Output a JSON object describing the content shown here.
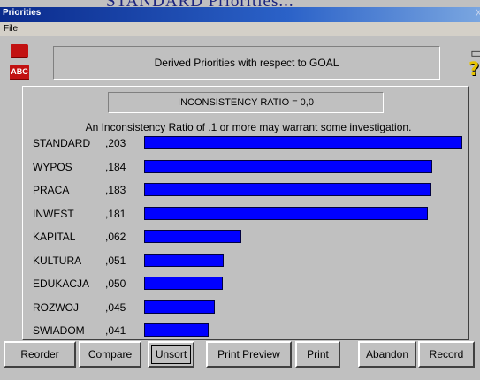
{
  "background_title": "STANDARD  Priorities...",
  "window": {
    "title": "Priorities",
    "close": "X"
  },
  "menu": {
    "file": "File"
  },
  "toolbar": {
    "abc_icon_text": "ABC"
  },
  "header": {
    "text": "Derived Priorities with respect to GOAL"
  },
  "inconsistency": {
    "label": "INCONSISTENCY RATIO = 0,0",
    "note": "An Inconsistency Ratio of .1 or more may warrant some investigation."
  },
  "chart_data": {
    "type": "bar",
    "categories": [
      "STANDARD",
      "WYPOS",
      "PRACA",
      "INWEST",
      "KAPITAL",
      "KULTURA",
      "EDUKACJA",
      "ROZWOJ",
      "SWIADOM"
    ],
    "value_labels": [
      ",203",
      ",184",
      ",183",
      ",181",
      ",062",
      ",051",
      ",050",
      ",045",
      ",041"
    ],
    "values": [
      0.203,
      0.184,
      0.183,
      0.181,
      0.062,
      0.051,
      0.05,
      0.045,
      0.041
    ],
    "bar_color": "#0000ff",
    "orientation": "horizontal"
  },
  "buttons": {
    "reorder": "Reorder",
    "compare": "Compare",
    "unsort": "Unsort",
    "print_preview": "Print Preview",
    "print": "Print",
    "abandon": "Abandon",
    "record": "Record"
  }
}
